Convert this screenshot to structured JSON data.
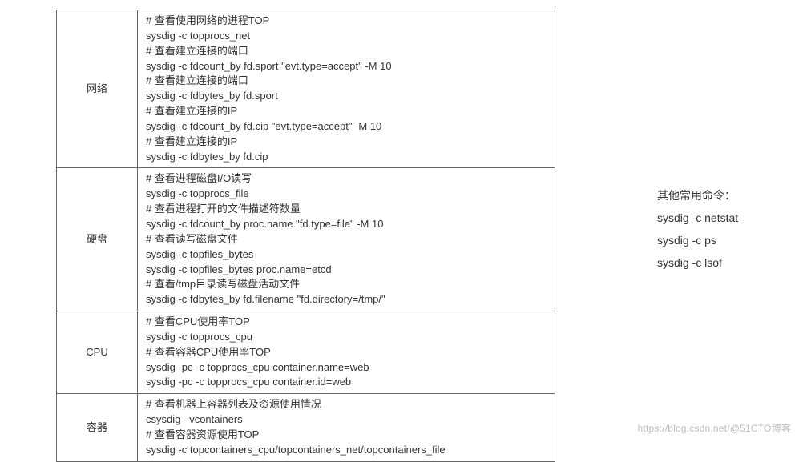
{
  "table": {
    "rows": [
      {
        "category": "网络",
        "lines": [
          "# 查看使用网络的进程TOP",
          "sysdig -c topprocs_net",
          "# 查看建立连接的端口",
          "sysdig -c fdcount_by fd.sport \"evt.type=accept\" -M 10",
          "# 查看建立连接的端口",
          "sysdig -c fdbytes_by fd.sport",
          "# 查看建立连接的IP",
          "sysdig -c fdcount_by fd.cip \"evt.type=accept\" -M 10",
          "# 查看建立连接的IP",
          "sysdig -c fdbytes_by fd.cip"
        ]
      },
      {
        "category": "硬盘",
        "lines": [
          "# 查看进程磁盘I/O读写",
          "sysdig -c topprocs_file",
          "# 查看进程打开的文件描述符数量",
          "sysdig -c fdcount_by proc.name \"fd.type=file\" -M 10",
          "# 查看读写磁盘文件",
          "sysdig -c topfiles_bytes",
          "sysdig -c topfiles_bytes proc.name=etcd",
          "# 查看/tmp目录读写磁盘活动文件",
          "sysdig -c fdbytes_by fd.filename \"fd.directory=/tmp/\""
        ]
      },
      {
        "category": "CPU",
        "lines": [
          "# 查看CPU使用率TOP",
          "sysdig -c topprocs_cpu",
          "# 查看容器CPU使用率TOP",
          "sysdig -pc -c topprocs_cpu container.name=web",
          "sysdig -pc -c topprocs_cpu container.id=web"
        ]
      },
      {
        "category": "容器",
        "lines": [
          "# 查看机器上容器列表及资源使用情况",
          "csysdig –vcontainers",
          "# 查看容器资源使用TOP",
          "sysdig -c topcontainers_cpu/topcontainers_net/topcontainers_file"
        ]
      }
    ]
  },
  "side": {
    "title": "其他常用命令：",
    "lines": [
      "sysdig -c netstat",
      "sysdig -c ps",
      "sysdig -c lsof"
    ]
  },
  "watermark": "https://blog.csdn.net/@51CTO博客"
}
